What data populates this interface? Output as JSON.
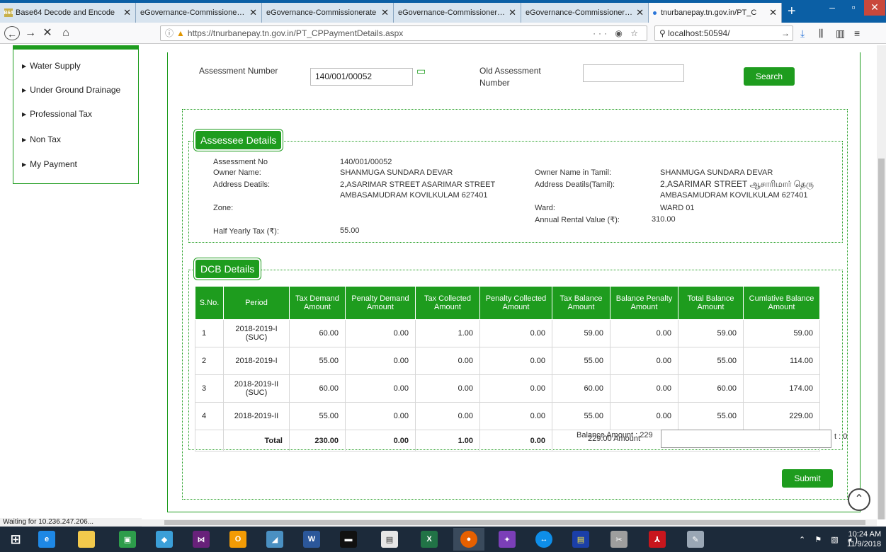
{
  "browser": {
    "tabs": [
      {
        "title": "Base64 Decode and Encode",
        "favicon": "B64"
      },
      {
        "title": "eGovernance-Commissionerate"
      },
      {
        "title": "eGovernance-Commissionerate"
      },
      {
        "title": "eGovernance-Commissionerate"
      },
      {
        "title": "eGovernance-Commissionerate"
      },
      {
        "title": "tnurbanepay.tn.gov.in/PT_C"
      }
    ],
    "url": "https://tnurbanepay.tn.gov.in/PT_CPPaymentDetails.aspx",
    "search_value": "localhost:50594/",
    "status_text": "Waiting for 10.236.247.206..."
  },
  "sidebar": {
    "items": [
      {
        "label": "Water Supply"
      },
      {
        "label": "Under Ground Drainage"
      },
      {
        "label": "Professional Tax"
      },
      {
        "label": "Non Tax"
      },
      {
        "label": "My Payment"
      }
    ]
  },
  "search_form": {
    "assessment_label": "Assessment Number",
    "assessment_value": "140/001/00052",
    "old_assessment_label_1": "Old Assessment",
    "old_assessment_label_2": "Number",
    "old_assessment_value": "",
    "search_button": "Search"
  },
  "assessee": {
    "legend": "Assessee Details",
    "assessment_no_label": "Assessment No",
    "assessment_no": "140/001/00052",
    "owner_name_label": "Owner Name:",
    "owner_name": "SHANMUGA SUNDARA DEVAR",
    "address_label": "Address Deatils:",
    "address_line1": "2,ASARIMAR STREET ASARIMAR STREET",
    "address_line2": "AMBASAMUDRAM KOVILKULAM 627401",
    "zone_label": "Zone:",
    "zone": "",
    "half_yearly_label": "Half Yearly Tax (₹):",
    "half_yearly": "55.00",
    "owner_tamil_label": "Owner Name in Tamil:",
    "owner_tamil": "SHANMUGA SUNDARA DEVAR",
    "address_tamil_label": "Address Deatils(Tamil):",
    "address_tamil_line1": "2,ASARIMAR STREET ஆசாரிமார் தெரு",
    "address_tamil_line2": "AMBASAMUDRAM KOVILKULAM 627401",
    "ward_label": "Ward:",
    "ward": "WARD 01",
    "arv_label": "Annual Rental Value (₹):",
    "arv": "310.00"
  },
  "dcb": {
    "legend": "DCB Details",
    "headers": [
      "S.No.",
      "Period",
      "Tax Demand Amount",
      "Penalty Demand Amount",
      "Tax Collected Amount",
      "Penalty Collected Amount",
      "Tax Balance Amount",
      "Balance Penalty Amount",
      "Total Balance Amount",
      "Cumlative Balance Amount"
    ],
    "rows": [
      [
        "1",
        "2018-2019-I (SUC)",
        "60.00",
        "0.00",
        "1.00",
        "0.00",
        "59.00",
        "0.00",
        "59.00",
        "59.00"
      ],
      [
        "2",
        "2018-2019-I",
        "55.00",
        "0.00",
        "0.00",
        "0.00",
        "55.00",
        "0.00",
        "55.00",
        "114.00"
      ],
      [
        "3",
        "2018-2019-II (SUC)",
        "60.00",
        "0.00",
        "0.00",
        "0.00",
        "60.00",
        "0.00",
        "60.00",
        "174.00"
      ],
      [
        "4",
        "2018-2019-II",
        "55.00",
        "0.00",
        "0.00",
        "0.00",
        "55.00",
        "0.00",
        "55.00",
        "229.00"
      ]
    ],
    "total_label": "Total",
    "totals": [
      "230.00",
      "0.00",
      "1.00",
      "0.00"
    ],
    "balance_label": "Balance Amount : 229",
    "balance_overlap": "229.00 Amount",
    "balance_right": "t : 0",
    "submit_button": "Submit"
  },
  "taskbar": {
    "time": "10:24 AM",
    "date": "11/9/2018"
  }
}
